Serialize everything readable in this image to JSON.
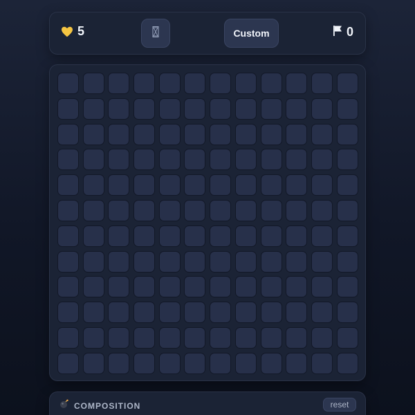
{
  "header": {
    "lives_icon": "heart-icon",
    "lives_count": "5",
    "timer_icon": "hourglass-icon",
    "custom_label": "Custom",
    "flags_icon": "flag-icon",
    "flags_count": "0"
  },
  "board": {
    "rows": 12,
    "cols": 12,
    "state": "all-unrevealed"
  },
  "composition": {
    "icon": "bomb-icon",
    "title": "COMPOSITION",
    "reset_label": "reset"
  },
  "colors": {
    "heart": "#f5c542",
    "cell": "#27304a",
    "panel": "#1b2335"
  }
}
